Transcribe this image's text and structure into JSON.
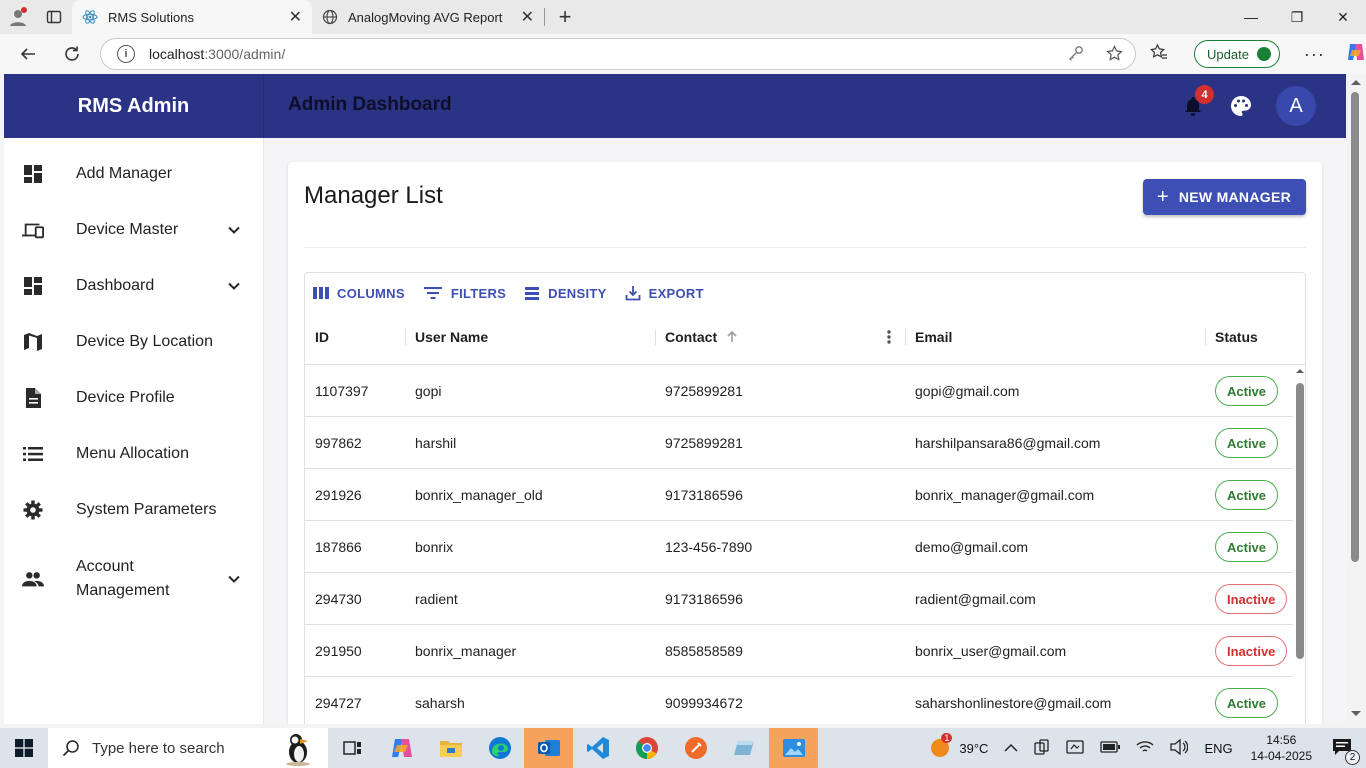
{
  "browser": {
    "tabs": [
      {
        "title": "RMS Solutions",
        "active": true
      },
      {
        "title": "AnalogMoving AVG Report",
        "active": false
      }
    ],
    "url_host": "localhost",
    "url_path": ":3000/admin/",
    "update_label": "Update"
  },
  "app": {
    "brand": "RMS Admin",
    "title": "Admin Dashboard",
    "notification_count": "4",
    "avatar_letter": "A",
    "header_color": "#2b3384"
  },
  "sidebar": {
    "items": [
      {
        "label": "Add Manager",
        "icon": "dashboard-icon",
        "expandable": false
      },
      {
        "label": "Device Master",
        "icon": "devices-icon",
        "expandable": true
      },
      {
        "label": "Dashboard",
        "icon": "dashboard-icon",
        "expandable": true
      },
      {
        "label": "Device By Location",
        "icon": "map-icon",
        "expandable": false
      },
      {
        "label": "Device Profile",
        "icon": "document-icon",
        "expandable": false
      },
      {
        "label": "Menu Allocation",
        "icon": "list-icon",
        "expandable": false
      },
      {
        "label": "System Parameters",
        "icon": "gear-icon",
        "expandable": false
      },
      {
        "label": "Account Management",
        "icon": "people-icon",
        "expandable": true
      }
    ]
  },
  "page": {
    "title": "Manager List",
    "new_button": "NEW MANAGER",
    "toolbar": {
      "columns": "COLUMNS",
      "filters": "FILTERS",
      "density": "DENSITY",
      "export": "EXPORT"
    },
    "columns": [
      "ID",
      "User Name",
      "Contact",
      "Email",
      "Status"
    ],
    "rows": [
      {
        "id": "1107397",
        "user": "gopi",
        "contact": "9725899281",
        "email": "gopi@gmail.com",
        "status": "Active"
      },
      {
        "id": "997862",
        "user": "harshil",
        "contact": "9725899281",
        "email": "harshilpansara86@gmail.com",
        "status": "Active"
      },
      {
        "id": "291926",
        "user": "bonrix_manager_old",
        "contact": "9173186596",
        "email": "bonrix_manager@gmail.com",
        "status": "Active"
      },
      {
        "id": "187866",
        "user": "bonrix",
        "contact": "123-456-7890",
        "email": "demo@gmail.com",
        "status": "Active"
      },
      {
        "id": "294730",
        "user": "radient",
        "contact": "9173186596",
        "email": "radient@gmail.com",
        "status": "Inactive"
      },
      {
        "id": "291950",
        "user": "bonrix_manager",
        "contact": "8585858589",
        "email": "bonrix_user@gmail.com",
        "status": "Inactive"
      },
      {
        "id": "294727",
        "user": "saharsh",
        "contact": "9099934672",
        "email": "saharshonlinestore@gmail.com",
        "status": "Active"
      }
    ]
  },
  "taskbar": {
    "search_placeholder": "Type here to search",
    "weather_badge": "1",
    "temperature": "39°C",
    "language": "ENG",
    "time": "14:56",
    "date": "14-04-2025",
    "notifications": "2"
  }
}
